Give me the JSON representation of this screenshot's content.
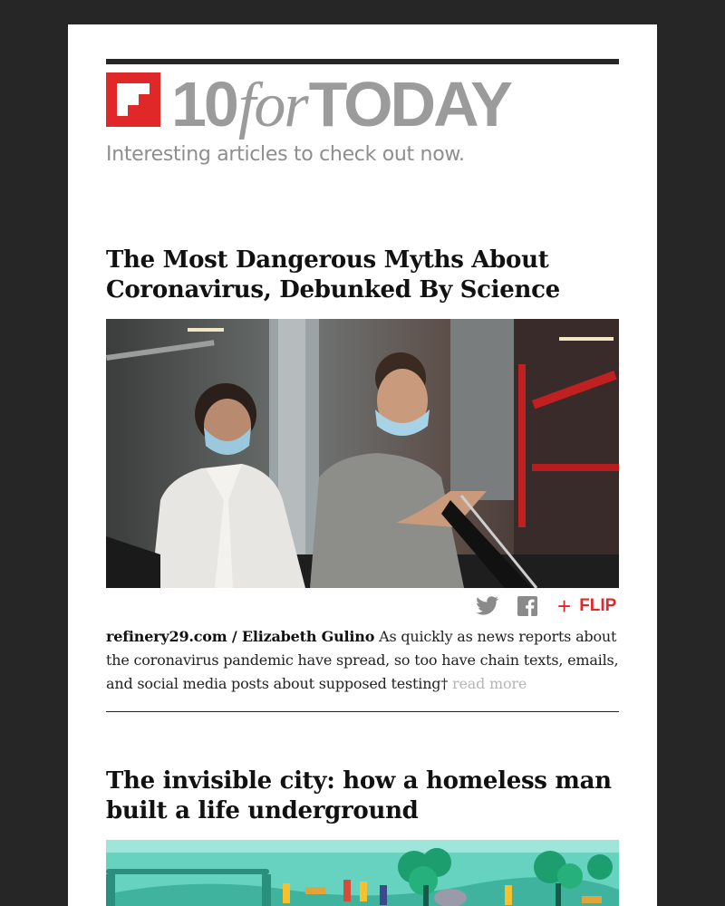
{
  "brand": {
    "number": "10",
    "connector": "for",
    "word": "TODAY",
    "tagline": "Interesting articles to check out now."
  },
  "colors": {
    "background": "#262626",
    "card": "#ffffff",
    "accent": "#e12828",
    "brand_gray": "#9b9b9b",
    "muted": "#b5b5b5"
  },
  "icons": {
    "logo": "flipboard-logo-icon",
    "twitter": "twitter-icon",
    "facebook": "facebook-icon",
    "flip": "plus-icon"
  },
  "articles": [
    {
      "title": "The Most Dangerous Myths About Coronavirus, Debunked By Science",
      "image": "photo of a man and a woman wearing surgical masks on an escalator",
      "source": "refinery29.com / Elizabeth Gulino",
      "summary": "As quickly as news reports about the coronavirus pandemic have spread, so too have chain texts, emails, and social media posts about supposed testing†",
      "read_more": "read more",
      "flip_label": "FLIP",
      "flip_plus": "+"
    },
    {
      "title": "The invisible city: how a homeless man built a life underground",
      "image": "illustration of a city park with people and trees"
    }
  ]
}
